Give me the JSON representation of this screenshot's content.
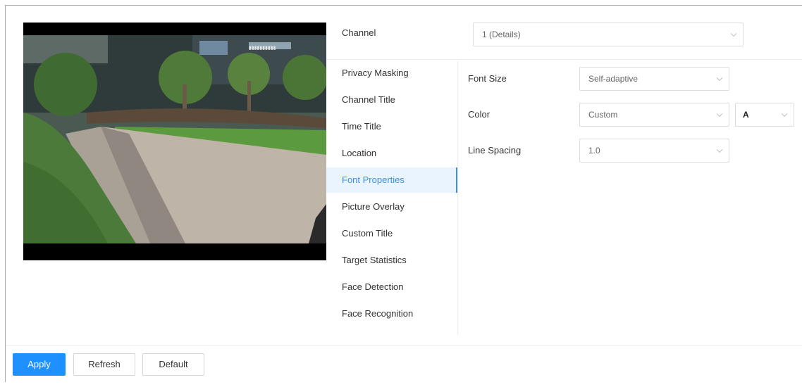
{
  "channel": {
    "label": "Channel",
    "value": "1 (Details)"
  },
  "menu": {
    "items": [
      {
        "label": "Privacy Masking"
      },
      {
        "label": "Channel Title"
      },
      {
        "label": "Time Title"
      },
      {
        "label": "Location"
      },
      {
        "label": "Font Properties",
        "active": true
      },
      {
        "label": "Picture Overlay"
      },
      {
        "label": "Custom Title"
      },
      {
        "label": "Target Statistics"
      },
      {
        "label": "Face Detection"
      },
      {
        "label": "Face Recognition"
      }
    ]
  },
  "font_properties": {
    "font_size": {
      "label": "Font Size",
      "value": "Self-adaptive"
    },
    "color": {
      "label": "Color",
      "value": "Custom",
      "swatch_glyph": "A"
    },
    "line_spacing": {
      "label": "Line Spacing",
      "value": "1.0"
    }
  },
  "buttons": {
    "apply": "Apply",
    "refresh": "Refresh",
    "default": "Default"
  },
  "colors": {
    "accent": "#1e90ff",
    "active_bg": "#eaf4ff",
    "active_text": "#3c8fe6"
  }
}
